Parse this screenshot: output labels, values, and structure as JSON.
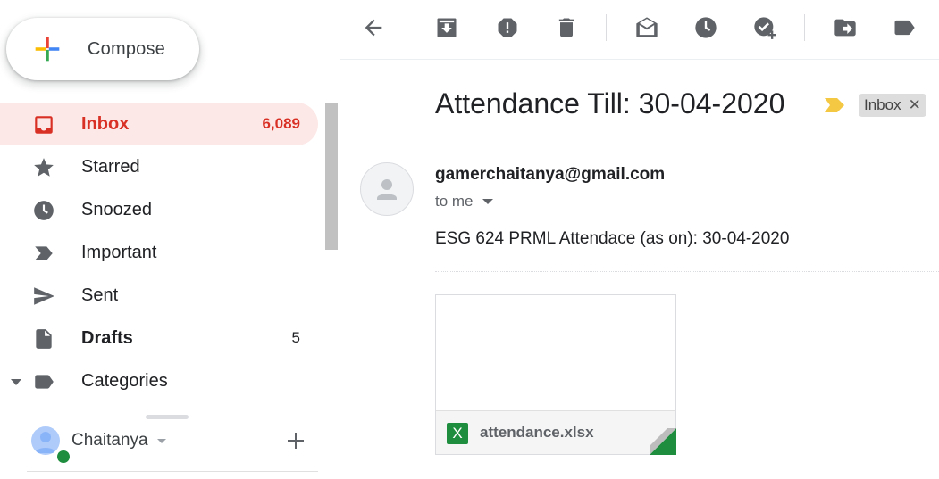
{
  "compose": {
    "label": "Compose"
  },
  "nav": [
    {
      "label": "Inbox",
      "count": "6,089",
      "icon": "inbox-icon"
    },
    {
      "label": "Starred",
      "count": "",
      "icon": "star-icon"
    },
    {
      "label": "Snoozed",
      "count": "",
      "icon": "clock-icon"
    },
    {
      "label": "Important",
      "count": "",
      "icon": "important-icon"
    },
    {
      "label": "Sent",
      "count": "",
      "icon": "send-icon"
    },
    {
      "label": "Drafts",
      "count": "5",
      "icon": "draft-icon"
    },
    {
      "label": "Categories",
      "count": "",
      "icon": "label-icon"
    }
  ],
  "hangouts": {
    "user": "Chaitanya"
  },
  "toolbar": {
    "buttons": [
      "back-icon",
      "archive-icon",
      "report-spam-icon",
      "delete-icon",
      "mark-unread-icon",
      "snooze-icon",
      "add-to-tasks-icon",
      "move-to-icon",
      "labels-icon"
    ]
  },
  "message": {
    "subject": "Attendance Till: 30-04-2020",
    "label_chip": "Inbox",
    "sender": "gamerchaitanya@gmail.com",
    "recipient": "to me",
    "body": "ESG 624 PRML Attendace (as on): 30-04-2020",
    "attachment": {
      "filename": "attendance.xlsx",
      "type_letter": "X"
    }
  },
  "colors": {
    "accent": "#d93025",
    "active_bg": "#fce8e6",
    "excel_green": "#1e8e3e",
    "important_yellow": "#f4c842"
  }
}
